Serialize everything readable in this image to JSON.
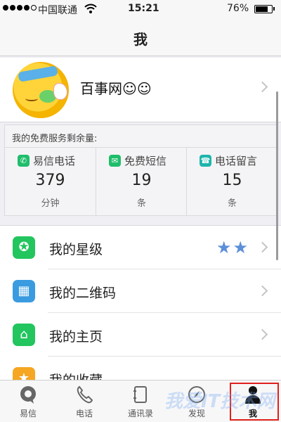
{
  "status_bar": {
    "carrier": "中国联通",
    "time": "15:21",
    "battery_text": "76%",
    "battery_level": 0.76,
    "signal_strength": 4,
    "signal_max": 5
  },
  "nav": {
    "title": "我"
  },
  "profile": {
    "name": "百事网☺☺"
  },
  "services": {
    "header": "我的免费服务剩余量:",
    "items": [
      {
        "label": "易信电话",
        "value": "379",
        "unit": "分钟",
        "icon": "phone-icon",
        "color": "#1fbe6b"
      },
      {
        "label": "免费短信",
        "value": "19",
        "unit": "条",
        "icon": "message-icon",
        "color": "#1fbe6b"
      },
      {
        "label": "电话留言",
        "value": "15",
        "unit": "条",
        "icon": "voicemail-icon",
        "color": "#1fb5ad"
      }
    ]
  },
  "menu": {
    "items": [
      {
        "label": "我的星级",
        "icon": "star-level-icon",
        "color": "#22c55e",
        "stars": "★★"
      },
      {
        "label": "我的二维码",
        "icon": "qr-code-icon",
        "color": "#3a9be0"
      },
      {
        "label": "我的主页",
        "icon": "homepage-icon",
        "color": "#22c55e"
      },
      {
        "label": "我的收藏",
        "icon": "favorites-icon",
        "color": "#f5a623"
      }
    ]
  },
  "tabs": [
    {
      "label": "易信",
      "icon": "yixin-icon"
    },
    {
      "label": "电话",
      "icon": "phone-icon"
    },
    {
      "label": "通讯录",
      "icon": "contacts-icon"
    },
    {
      "label": "发现",
      "icon": "compass-icon"
    },
    {
      "label": "我",
      "icon": "person-icon",
      "selected": true
    }
  ],
  "watermark": "我爱IT技术网"
}
